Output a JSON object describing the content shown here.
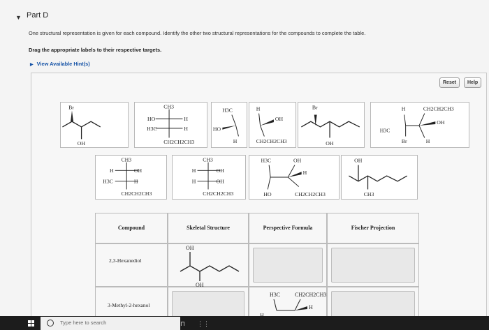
{
  "header": {
    "part_label": "Part D"
  },
  "instructions": {
    "line1": "One structural representation is given for each compound. Identify the other two structural representations for the compounds to complete the table.",
    "line2": "Drag the appropriate labels to their respective targets.",
    "hint_link": "View Available Hint(s)"
  },
  "toolbar": {
    "reset_label": "Reset",
    "help_label": "Help"
  },
  "structures": {
    "br": "Br",
    "oh": "OH",
    "h": "H",
    "ho": "HO",
    "ch3": "CH3",
    "h3c": "H3C",
    "ch2ch2ch3": "CH2CH2CH3",
    "ch2ch3": "CH2CH3",
    "ch2ch2ch3_top": "CH2CH2CH3"
  },
  "table": {
    "headers": {
      "compound": "Compound",
      "skeletal": "Skeletal Structure",
      "perspective": "Perspective Formula",
      "fischer": "Fischer Projection"
    },
    "rows": [
      {
        "compound": "2,3-Hexanediol"
      },
      {
        "compound": "3-Methyl-2-hexanol"
      }
    ]
  },
  "taskbar": {
    "search_placeholder": "Type here to search"
  },
  "colors": {
    "link": "#1a56a8",
    "panel": "#f7f7f7",
    "target": "#e8e8e8"
  }
}
